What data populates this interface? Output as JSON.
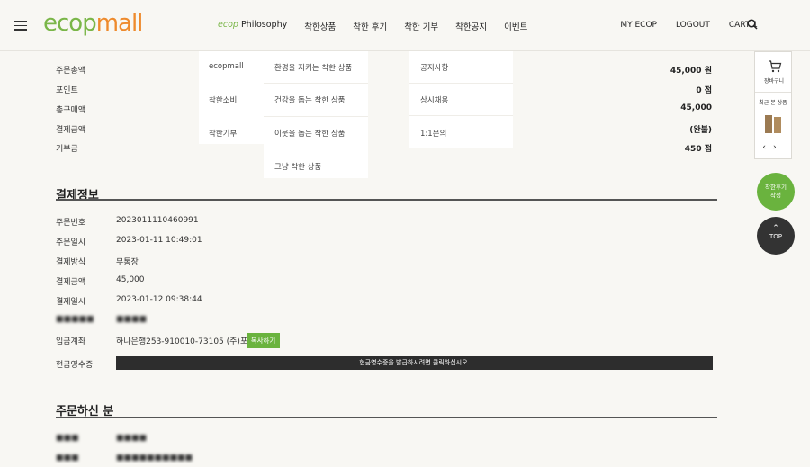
{
  "header": {
    "logo_eco": "ecop",
    "logo_mall": "mall",
    "nav": {
      "philosophy_prefix": "ecop",
      "philosophy": "Philosophy",
      "good_products": "착한상품",
      "good_reviews": "착한 후기",
      "good_donation": "착한 기부",
      "good_notice": "착한공지",
      "event": "이벤트"
    },
    "util": {
      "my_ecop": "MY ECOP",
      "logout": "LOGOUT",
      "cart": "CART 1"
    }
  },
  "summary": [
    {
      "label": "주문총액",
      "value": "45,000 원"
    },
    {
      "label": "포인트",
      "value": "0 점"
    },
    {
      "label": "총구매액",
      "value": "45,000"
    },
    {
      "label": "결제금액",
      "value": "(완불)"
    },
    {
      "label": "기부금",
      "value": "450 점"
    }
  ],
  "dropdown": {
    "col1": [
      "ecopmall",
      "착한소비",
      "착한기부"
    ],
    "col2": [
      "환경을 지키는 착한 상품",
      "건강을 돕는 착한 상품",
      "이웃을 돕는 착한 상품",
      "그냥 착한 상품"
    ],
    "col3": [
      "공지사항",
      "상시채용",
      "1:1문의"
    ]
  },
  "payment": {
    "title": "결제정보",
    "rows": [
      {
        "k": "주문번호",
        "v": "20230111104609​91"
      },
      {
        "k": "주문일시",
        "v": "2023-01-11 10:49:01"
      },
      {
        "k": "결제방식",
        "v": "무통장"
      },
      {
        "k": "결제금액",
        "v": "45,000"
      },
      {
        "k": "결제일시",
        "v": "2023-01-12 09:38:44"
      }
    ],
    "account_label": "입금계좌",
    "account_value": "하나은행253-910010-73105 (주)포레",
    "copy_label": "복사하기",
    "receipt_label": "현금영수증",
    "receipt_bar": "현금영수증을 발급하시려면 클릭하십시오."
  },
  "orderer": {
    "title": "주문하신 분"
  },
  "quick": {
    "cart_label": "장바구니",
    "recent_label": "최근 본 상품",
    "prev": "‹",
    "next": "›",
    "review_line1": "착한후기",
    "review_line2": "작성",
    "top_label": "TOP"
  }
}
